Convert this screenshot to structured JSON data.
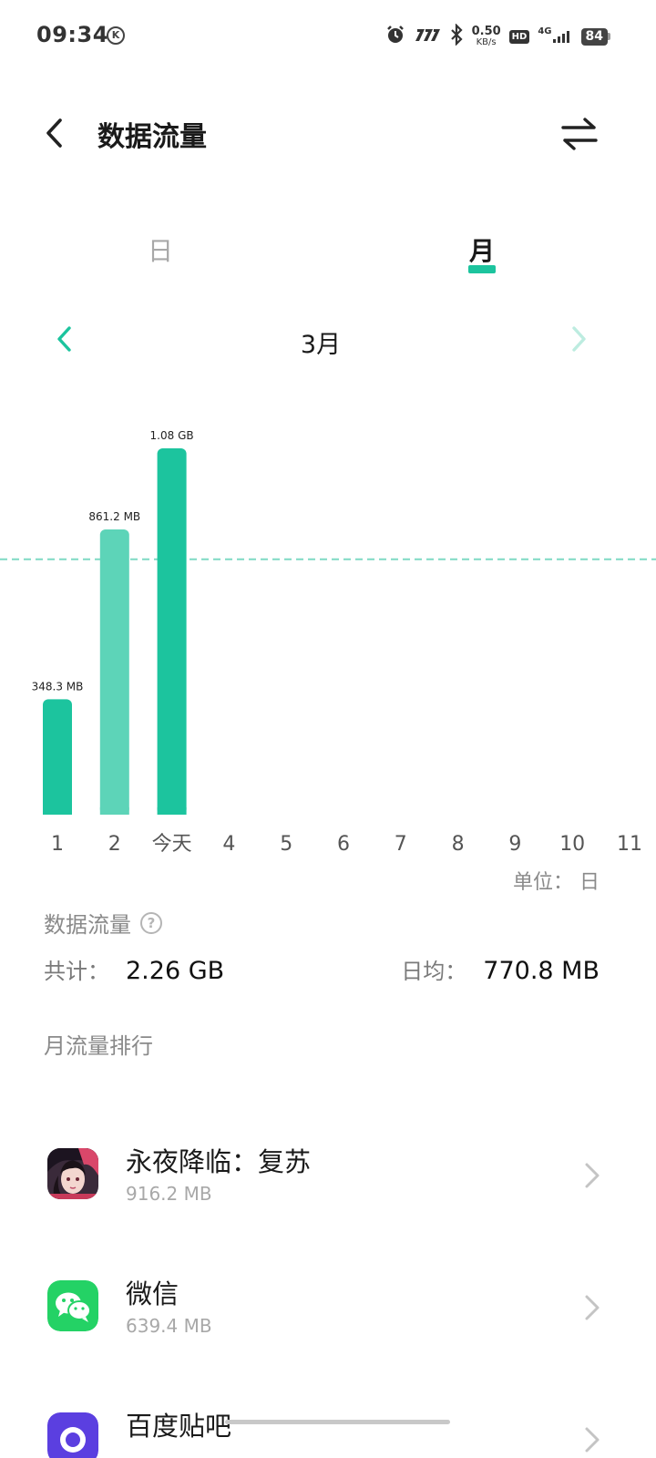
{
  "status_bar": {
    "time": "09:34",
    "k_badge": "K",
    "speed_value": "0.50",
    "speed_unit": "KB/s",
    "hd": "HD",
    "network": "4G",
    "battery": "84"
  },
  "header": {
    "title": "数据流量"
  },
  "tabs": [
    {
      "label": "日",
      "active": false
    },
    {
      "label": "月",
      "active": true
    }
  ],
  "month_nav": {
    "label": "3月"
  },
  "chart_data": {
    "type": "bar",
    "categories": [
      "1",
      "2",
      "今天",
      "4",
      "5",
      "6",
      "7",
      "8",
      "9",
      "10",
      "11"
    ],
    "values_mb": [
      348.3,
      861.2,
      1105.9,
      null,
      null,
      null,
      null,
      null,
      null,
      null,
      null
    ],
    "data_labels": [
      "348.3 MB",
      "861.2 MB",
      "1.08 GB"
    ],
    "average_mb": 770.8,
    "colors": [
      "#1cc49e",
      "#5dd4b8",
      "#1cc49e"
    ],
    "average_line_color": "#7fd9c4",
    "unit_label": "单位： 日"
  },
  "summary": {
    "section_title": "数据流量",
    "total_key": "共计：",
    "total_value": "2.26 GB",
    "avg_key": "日均：",
    "avg_value": "770.8 MB"
  },
  "ranking": {
    "title": "月流量排行",
    "apps": [
      {
        "name": "永夜降临：复苏",
        "usage": "916.2 MB",
        "icon": "game-avatar-icon"
      },
      {
        "name": "微信",
        "usage": "639.4 MB",
        "icon": "wechat-icon"
      },
      {
        "name": "百度贴吧",
        "usage": "",
        "icon": "tieba-icon"
      }
    ]
  },
  "colors": {
    "accent": "#1cc49e",
    "accent_light": "#5dd4b8",
    "wechat_green": "#24d265",
    "tieba_purple": "#5b3fe0"
  }
}
